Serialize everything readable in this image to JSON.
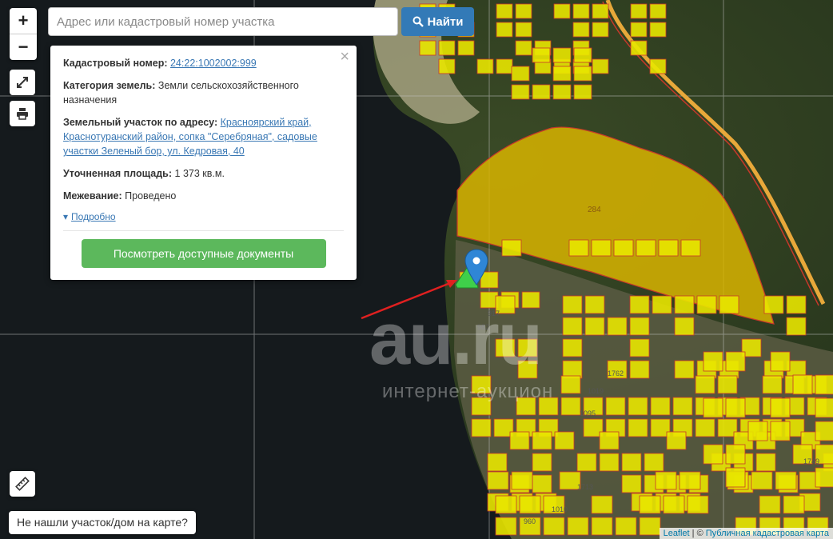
{
  "search": {
    "placeholder": "Адрес или кадастровый номер участка",
    "button_label": "Найти"
  },
  "map_controls": {
    "zoom_in": "+",
    "zoom_out": "−"
  },
  "popup": {
    "cadastral_label": "Кадастровый номер:",
    "cadastral_value": "24:22:1002002:999",
    "category_label": "Категория земель:",
    "category_value": "Земли сельскохозяйственного назначения",
    "address_label": "Земельный участок по адресу:",
    "address_value": "Красноярский край, Краснотуранский район, сопка \"Серебряная\", садовые участки Зеленый бор, ул. Кедровая, 40",
    "area_label": "Уточненная площадь:",
    "area_value": "1 373 кв.м.",
    "survey_label": "Межевание:",
    "survey_value": "Проведено",
    "more_label": "Подробно",
    "docs_button": "Посмотреть доступные документы",
    "close_symbol": "×"
  },
  "not_found_button": "Не нашли участок/дом на карте?",
  "attribution": {
    "leaflet": "Leaflet",
    "separator": " | © ",
    "source": "Публичная кадастровая карта"
  },
  "watermark": {
    "logo": "au.ru",
    "tagline": "интернет-аукцион"
  },
  "map_labels": [
    "284",
    "1762",
    "1749",
    "960",
    "1010",
    "982",
    "917",
    "1095",
    "1019",
    "1713"
  ],
  "colors": {
    "parcel_fill": "#e8e600",
    "large_parcel_fill": "#d8b400",
    "parcel_border": "#c8382a",
    "selected_parcel": "#3fcf4a",
    "marker": "#2f86d6",
    "arrow": "#e02020",
    "road": "#e8a83a"
  }
}
